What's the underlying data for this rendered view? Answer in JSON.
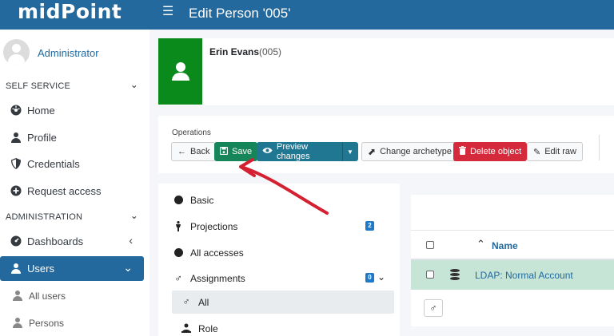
{
  "app": {
    "brand": "midPoint",
    "page_title": "Edit Person '005'",
    "menu_icon": "hamburger-icon"
  },
  "colors": {
    "brand_blue": "#23699d",
    "success": "#16855a",
    "primary": "#1f7791",
    "danger": "#d42a3b",
    "archetype_green": "#0a8a1b",
    "selected_row": "#c6e5d6",
    "annotation": "#d42030"
  },
  "sidebar": {
    "user_name": "Administrator",
    "sections": [
      "SELF SERVICE",
      "ADMINISTRATION"
    ],
    "self_service": [
      {
        "label": "Home",
        "icon": "home-icon"
      },
      {
        "label": "Profile",
        "icon": "user-icon"
      },
      {
        "label": "Credentials",
        "icon": "shield-icon"
      },
      {
        "label": "Request access",
        "icon": "plus-circle-icon"
      }
    ],
    "administration": [
      {
        "label": "Dashboards",
        "icon": "dashboard-icon"
      },
      {
        "label": "Users",
        "icon": "user-icon",
        "active": true
      },
      {
        "label": "All users",
        "icon": "user-icon"
      },
      {
        "label": "Persons",
        "icon": "user-icon"
      }
    ]
  },
  "header": {
    "name": "Erin Evans",
    "id": "(005)"
  },
  "operations": {
    "title": "Operations",
    "back": "Back",
    "save": "Save",
    "preview": "Preview changes",
    "change_archetype": "Change archetype",
    "delete": "Delete object",
    "edit_raw": "Edit raw"
  },
  "menu": {
    "items": [
      {
        "label": "Basic"
      },
      {
        "label": "Projections",
        "badge": "2"
      },
      {
        "label": "All accesses"
      },
      {
        "label": "Assignments",
        "badge": "0"
      },
      {
        "label": "All",
        "selected": true
      },
      {
        "label": "Role"
      }
    ]
  },
  "table": {
    "header": "Name",
    "rows": [
      {
        "name": "LDAP: Normal Account"
      }
    ]
  }
}
